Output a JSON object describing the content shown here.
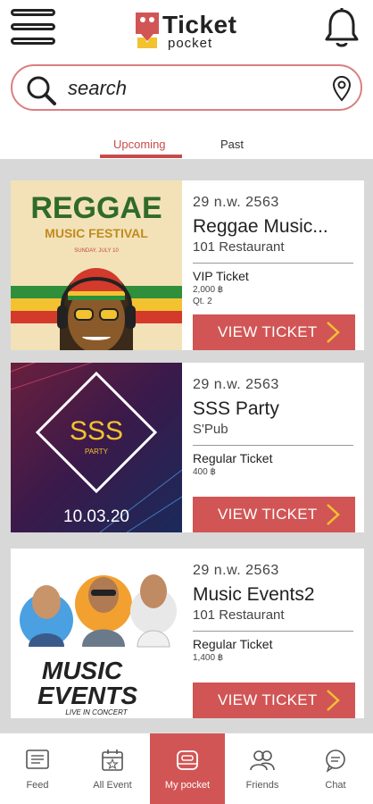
{
  "header": {
    "logo_line1": "Ticket",
    "logo_line2": "pocket"
  },
  "search": {
    "placeholder": "search"
  },
  "tabs": [
    {
      "label": "Upcoming",
      "active": true
    },
    {
      "label": "Past",
      "active": false
    }
  ],
  "tickets": [
    {
      "date": "29 n.w. 2563",
      "title": "Reggae Music...",
      "venue": "101 Restaurant",
      "ticket_type": "VIP Ticket",
      "price": "2,000 ฿",
      "qty": "Qt. 2",
      "button": "VIEW TICKET",
      "poster": {
        "headline": "REGGAE",
        "sub": "MUSIC FESTIVAL",
        "sub2": "SUNDAY, JULY 10"
      }
    },
    {
      "date": "29 n.w. 2563",
      "title": "SSS Party",
      "venue": "S'Pub",
      "ticket_type": "Regular Ticket",
      "price": "400 ฿",
      "button": "VIEW TICKET",
      "poster": {
        "headline": "SSS",
        "sub": "PARTY",
        "date": "10.03.20"
      }
    },
    {
      "date": "29 n.w. 2563",
      "title": "Music Events2",
      "venue": "101 Restaurant",
      "ticket_type": "Regular Ticket",
      "price": "1,400 ฿",
      "button": "VIEW TICKET",
      "poster": {
        "headline1": "MUSIC",
        "headline2": "EVENTS",
        "sub": "LIVE IN CONCERT"
      }
    }
  ],
  "nav": [
    {
      "label": "Feed",
      "icon": "feed-icon"
    },
    {
      "label": "All Event",
      "icon": "calendar-icon"
    },
    {
      "label": "My pocket",
      "icon": "pocket-icon",
      "active": true
    },
    {
      "label": "Friends",
      "icon": "friends-icon"
    },
    {
      "label": "Chat",
      "icon": "chat-icon"
    }
  ],
  "colors": {
    "accent": "#d25555",
    "search_border": "#d98080",
    "content_bg": "#d8d8d8"
  }
}
